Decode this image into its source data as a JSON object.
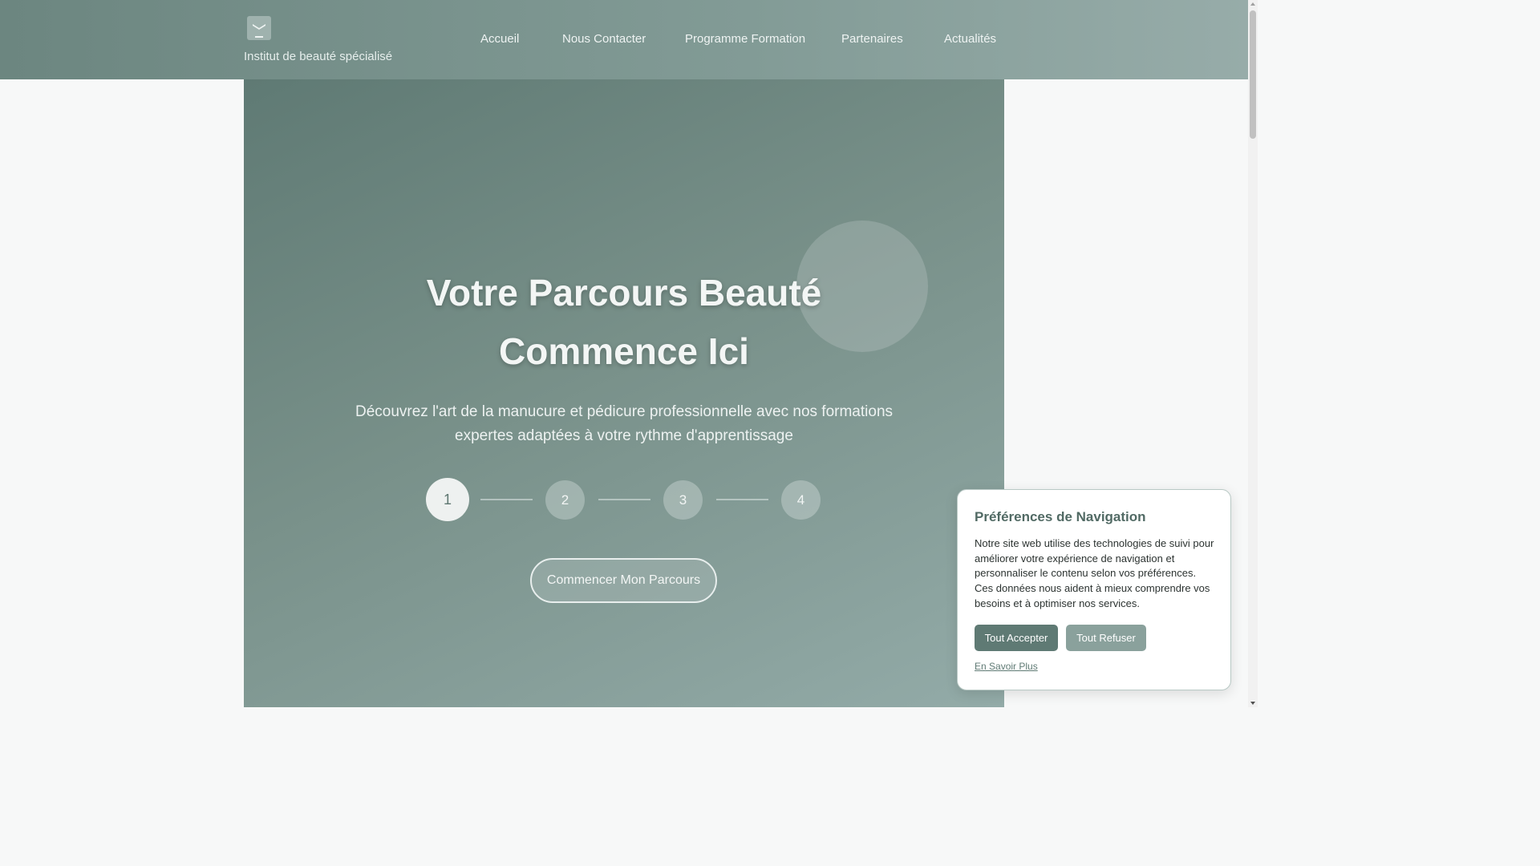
{
  "header": {
    "brand": "Institut de beauté spécialisé",
    "logo_icon": "nail-polish-logo-icon",
    "nav": [
      {
        "label": "Accueil"
      },
      {
        "label": "Nous Contacter"
      },
      {
        "label": "Programme Formation"
      },
      {
        "label": "Partenaires"
      },
      {
        "label": "Actualités"
      }
    ]
  },
  "hero": {
    "title_line1": "Votre Parcours Beauté",
    "title_line2": "Commence Ici",
    "subtitle_line1": "Découvrez l'art de la manucure et pédicure professionnelle avec nos formations",
    "subtitle_line2": "expertes adaptées à votre rythme d'apprentissage",
    "steps": [
      "1",
      "2",
      "3",
      "4"
    ],
    "active_step": 1,
    "cta_label": "Commencer Mon Parcours"
  },
  "cookie_banner": {
    "title": "Préférences de Navigation",
    "text": "Notre site web utilise des technologies de suivi pour améliorer votre expérience de navigation et personnaliser le contenu selon vos préférences. Ces données nous aident à mieux comprendre vos besoins et à optimiser nos services.",
    "accept_label": "Tout Accepter",
    "refuse_label": "Tout Refuser",
    "learn_more_label": "En Savoir Plus"
  },
  "colors": {
    "primary": "#5f7a74",
    "header_start": "#6c8680",
    "header_end": "#97aca9",
    "secondary_button": "#8aa19c"
  }
}
